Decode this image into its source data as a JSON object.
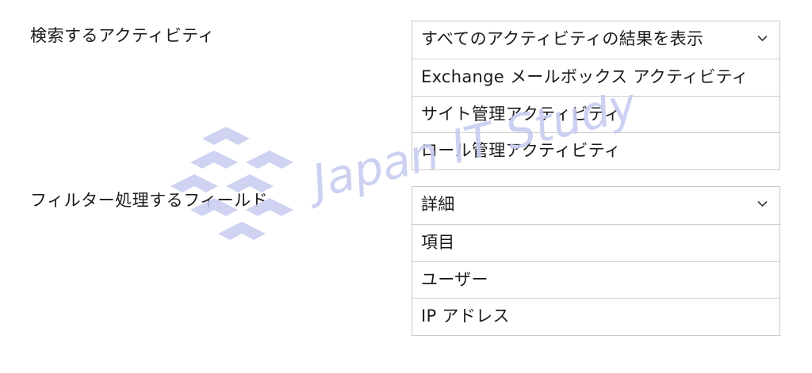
{
  "activity_search": {
    "label": "検索するアクティビティ",
    "selected": "すべてのアクティビティの結果を表示",
    "options": [
      "Exchange メールボックス アクティビティ",
      "サイト管理アクティビティ",
      "ロール管理アクティビティ"
    ]
  },
  "filter_field": {
    "label": "フィルター処理するフィールド",
    "selected": "詳細",
    "options": [
      "項目",
      "ユーザー",
      "IP アドレス"
    ]
  },
  "watermark": {
    "text": "Japan IT Study",
    "icon": "chevron-logo-icon",
    "color": "#c7ccef"
  },
  "icons": {
    "dropdown": "chevron-down-icon"
  }
}
